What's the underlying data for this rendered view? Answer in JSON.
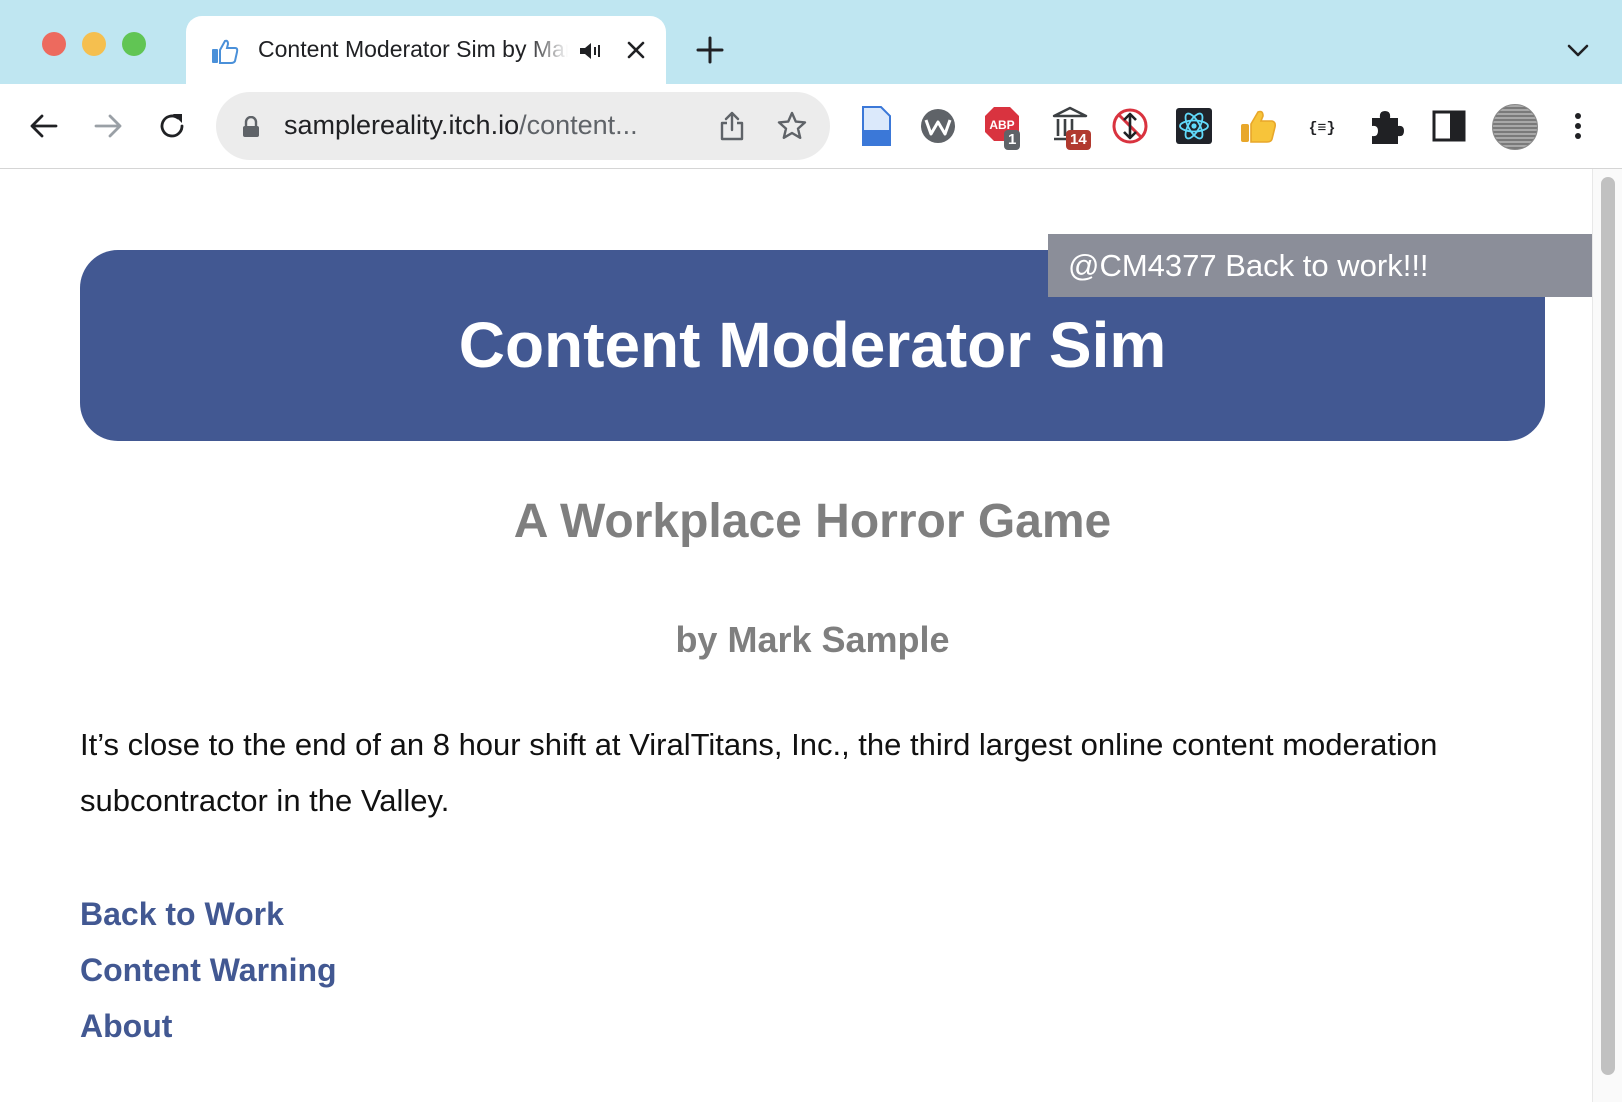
{
  "browser": {
    "tab": {
      "title": "Content Moderator Sim by Mark Sample"
    },
    "address_bar": {
      "host": "samplereality.itch.io",
      "path": "/content..."
    },
    "extensions": [
      {
        "name": "document-extension",
        "badge": ""
      },
      {
        "name": "w-extension",
        "badge": ""
      },
      {
        "name": "adblock-extension",
        "badge": "1"
      },
      {
        "name": "museum-extension",
        "badge": "14"
      },
      {
        "name": "blocked-arrows-extension",
        "badge": ""
      },
      {
        "name": "react-devtools-extension",
        "badge": ""
      },
      {
        "name": "thumbs-up-extension",
        "badge": ""
      },
      {
        "name": "json-extension",
        "badge": ""
      }
    ],
    "colors": {
      "tabstrip": "#bfe6f1",
      "badge_adblock": "#5f6368",
      "badge_museum": "#b13a2f"
    }
  },
  "page": {
    "notification": "@CM4377 Back to work!!!",
    "banner_title": "Content Moderator Sim",
    "subtitle": "A Workplace Horror Game",
    "byline": "by Mark Sample",
    "intro": "It’s close to the end of an 8 hour shift at ViralTitans, Inc., the third largest online content moderation subcontractor in the Valley.",
    "links": [
      {
        "label": "Back to Work"
      },
      {
        "label": "Content Warning"
      },
      {
        "label": "About"
      }
    ],
    "colors": {
      "banner": "#425892",
      "link": "#425892",
      "subtitle": "#7f7f7f",
      "notification_bg": "#8b8e99"
    }
  }
}
